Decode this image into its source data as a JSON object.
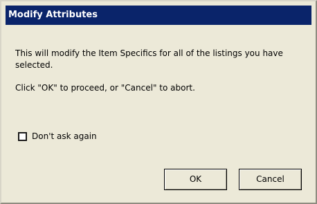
{
  "dialog": {
    "title": "Modify Attributes",
    "message_line1": "This will modify the Item Specifics for all of the listings you have selected.",
    "message_line2": "Click \"OK\" to proceed, or \"Cancel\" to abort.",
    "checkbox_label": "Don't ask again",
    "checkbox_checked": false,
    "ok_label": "OK",
    "cancel_label": "Cancel"
  },
  "colors": {
    "titlebar": "#0a246a",
    "title_text": "#ffffff",
    "dialog_background": "#ece9d8"
  }
}
